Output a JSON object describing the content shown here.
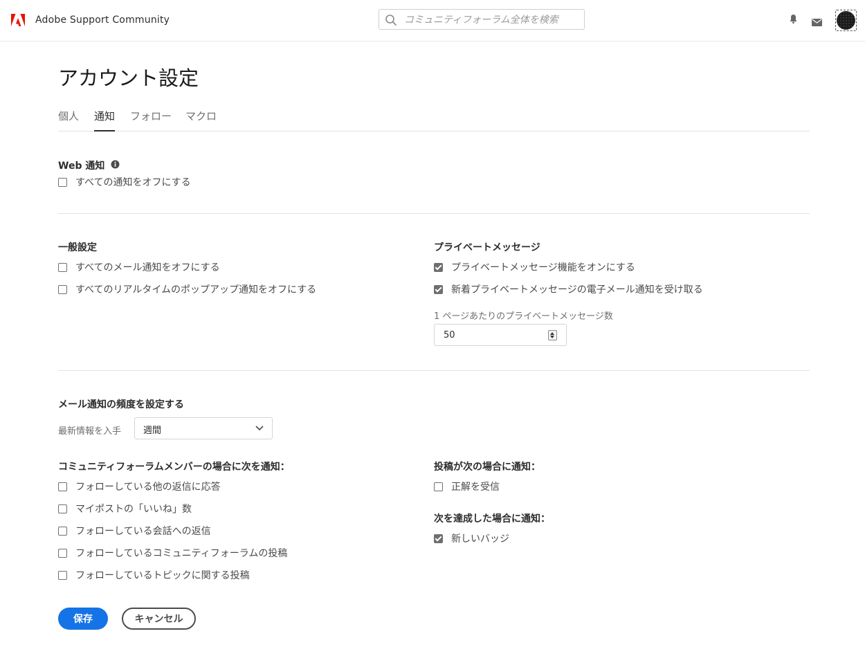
{
  "header": {
    "site_name": "Adobe Support Community",
    "search_placeholder": "コミュニティフォーラム全体を検索",
    "icons": [
      "adobe-logo-icon",
      "search-icon",
      "bell-icon",
      "mail-icon"
    ],
    "brand_color": "#eb1000"
  },
  "page": {
    "title": "アカウント設定",
    "tabs": [
      {
        "label": "個人",
        "active": false
      },
      {
        "label": "通知",
        "active": true
      },
      {
        "label": "フォロー",
        "active": false
      },
      {
        "label": "マクロ",
        "active": false
      }
    ]
  },
  "web_notifications": {
    "title": "Web 通知",
    "options": [
      {
        "label": "すべての通知をオフにする",
        "checked": false
      }
    ]
  },
  "general": {
    "title": "一般設定",
    "options": [
      {
        "label": "すべてのメール通知をオフにする",
        "checked": false
      },
      {
        "label": "すべてのリアルタイムのポップアップ通知をオフにする",
        "checked": false
      }
    ]
  },
  "private_messages": {
    "title": "プライベートメッセージ",
    "options": [
      {
        "label": "プライベートメッセージ機能をオンにする",
        "checked": true
      },
      {
        "label": "新着プライベートメッセージの電子メール通知を受け取る",
        "checked": true
      }
    ],
    "per_page_label": "1 ページあたりのプライベートメッセージ数",
    "per_page_value": "50"
  },
  "email_frequency": {
    "title": "メール通知の頻度を設定する",
    "label": "最新情報を入手",
    "selected": "週間"
  },
  "member_notify": {
    "title": "コミュニティフォーラムメンバーの場合に次を通知：",
    "options": [
      {
        "label": "フォローしている他の返信に応答",
        "checked": false
      },
      {
        "label": "マイポストの「いいね」数",
        "checked": false
      },
      {
        "label": "フォローしている会話への返信",
        "checked": false
      },
      {
        "label": "フォローしているコミュニティフォーラムの投稿",
        "checked": false
      },
      {
        "label": "フォローしているトピックに関する投稿",
        "checked": false
      }
    ]
  },
  "post_notify": {
    "title": "投稿が次の場合に通知：",
    "options": [
      {
        "label": "正解を受信",
        "checked": false
      }
    ]
  },
  "achievement_notify": {
    "title": "次を達成した場合に通知：",
    "options": [
      {
        "label": "新しいバッジ",
        "checked": true
      }
    ]
  },
  "actions": {
    "save_label": "保存",
    "cancel_label": "キャンセル",
    "primary_color": "#1473e6"
  }
}
